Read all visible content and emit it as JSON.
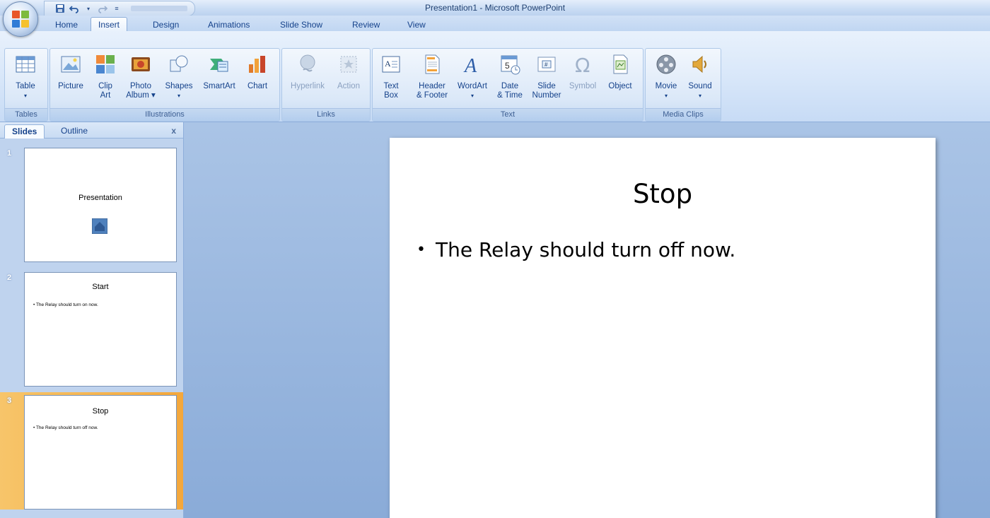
{
  "window": {
    "title": "Presentation1 - Microsoft PowerPoint"
  },
  "tabs": [
    "Home",
    "Insert",
    "Design",
    "Animations",
    "Slide Show",
    "Review",
    "View"
  ],
  "active_tab": "Insert",
  "ribbon": {
    "groups": [
      {
        "label": "Tables",
        "buttons": [
          {
            "l1": "Table",
            "l2": "▾"
          }
        ]
      },
      {
        "label": "Illustrations",
        "buttons": [
          {
            "l1": "Picture",
            "l2": ""
          },
          {
            "l1": "Clip",
            "l2": "Art"
          },
          {
            "l1": "Photo",
            "l2": "Album ▾"
          },
          {
            "l1": "Shapes",
            "l2": "▾"
          },
          {
            "l1": "SmartArt",
            "l2": ""
          },
          {
            "l1": "Chart",
            "l2": ""
          }
        ]
      },
      {
        "label": "Links",
        "buttons": [
          {
            "l1": "Hyperlink",
            "l2": ""
          },
          {
            "l1": "Action",
            "l2": ""
          }
        ]
      },
      {
        "label": "Text",
        "buttons": [
          {
            "l1": "Text",
            "l2": "Box"
          },
          {
            "l1": "Header",
            "l2": "& Footer"
          },
          {
            "l1": "WordArt",
            "l2": "▾"
          },
          {
            "l1": "Date",
            "l2": "& Time"
          },
          {
            "l1": "Slide",
            "l2": "Number"
          },
          {
            "l1": "Symbol",
            "l2": ""
          },
          {
            "l1": "Object",
            "l2": ""
          }
        ]
      },
      {
        "label": "Media Clips",
        "buttons": [
          {
            "l1": "Movie",
            "l2": "▾"
          },
          {
            "l1": "Sound",
            "l2": "▾"
          }
        ]
      }
    ]
  },
  "left_pane": {
    "tabs": [
      "Slides",
      "Outline"
    ],
    "close": "x",
    "slides": [
      {
        "number": "1",
        "title": "Presentation",
        "bullet": ""
      },
      {
        "number": "2",
        "title": "Start",
        "bullet": "• The Relay should turn on now."
      },
      {
        "number": "3",
        "title": "Stop",
        "bullet": "• The Relay should turn off now."
      }
    ]
  },
  "slide": {
    "title": "Stop",
    "bullet_marker": "•",
    "bullet": "The Relay should turn off now."
  },
  "colors": {
    "ribbon_text": "#15428b",
    "selected_thumb": "#f4a73b",
    "workspace": "#8aabd8"
  }
}
